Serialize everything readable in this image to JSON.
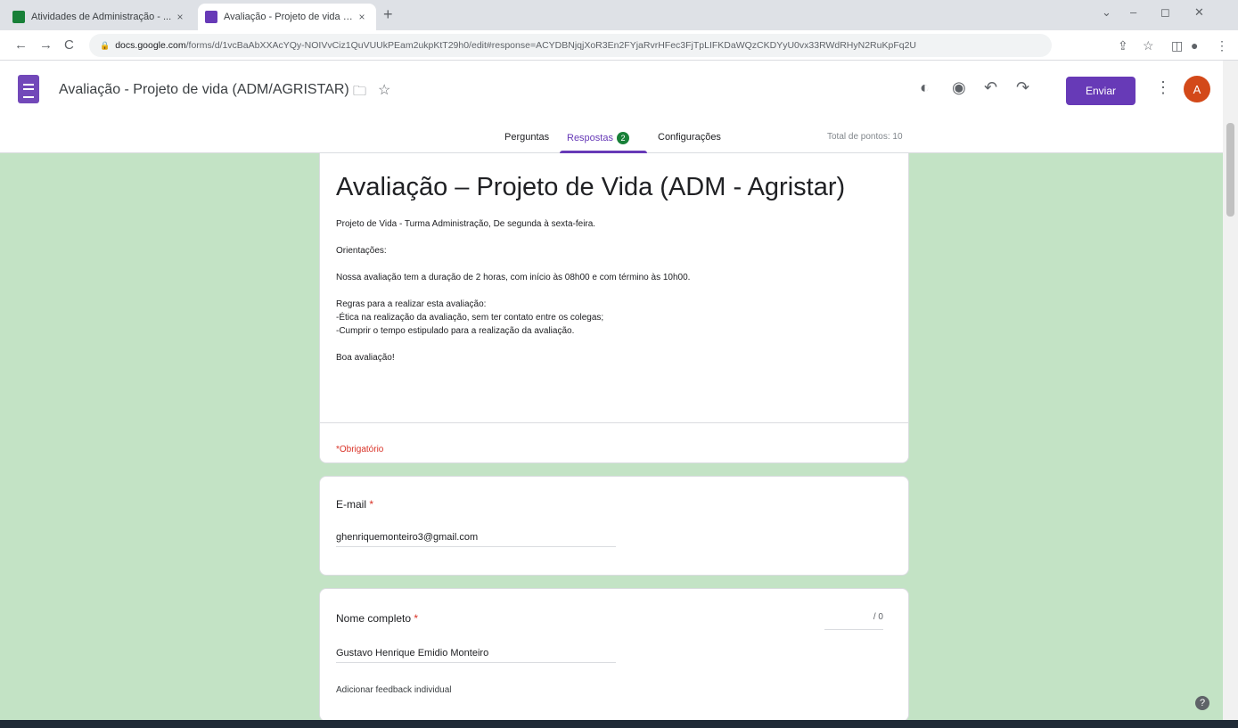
{
  "browser": {
    "tabs": [
      {
        "title": "Atividades de Administração - ...",
        "color": "#188038"
      },
      {
        "title": "Avaliação - Projeto de vida (ADI...",
        "color": "#673ab7"
      }
    ],
    "url_host": "docs.google.com",
    "url_path": "/forms/d/1vcBaAbXXAcYQy-NOIVvCiz1QuVUUkPEam2ukpKtT29h0/edit#response=ACYDBNjqjXoR3En2FYjaRvrHFec3FjTpLIFKDaWQzCKDYyU0vx33RWdRHyN2RuKpFq2U",
    "tab_close_glyph": "×",
    "new_tab_glyph": "+",
    "nav": {
      "back": "←",
      "forward": "→",
      "reload": "C"
    }
  },
  "forms": {
    "doc_title": "Avaliação - Projeto de vida (ADM/AGRISTAR)",
    "send_label": "Enviar",
    "avatar_letter": "A",
    "tabs": [
      {
        "label": "Perguntas"
      },
      {
        "label": "Respostas",
        "badge": "2"
      },
      {
        "label": "Configurações"
      }
    ],
    "total_points": "Total de pontos: 10",
    "accent": "#673ab7"
  },
  "form": {
    "title": "Avaliação – Projeto de Vida (ADM - Agristar)",
    "description": [
      "Projeto de Vida - Turma Administração, De segunda à sexta-feira.",
      "Orientações:",
      "Nossa avaliação tem a duração de  2 horas, com início às 08h00 e com término às 10h00.",
      "Regras para a realizar esta avaliação:",
      "-Ética na realização da avaliação, sem ter contato entre os colegas;",
      "-Cumprir o tempo estipulado para a realização da avaliação.",
      "Boa avaliação!"
    ],
    "required_note": "*Obrigatório",
    "email_label": "E-mail",
    "email_value": "ghenriquemonteiro3@gmail.com",
    "name_label": "Nome completo",
    "name_value": "Gustavo Henrique Emidio Monteiro",
    "name_points": "/ 0",
    "feedback_label": "Adicionar feedback individual",
    "required_marker": "*"
  },
  "help_glyph": "?"
}
